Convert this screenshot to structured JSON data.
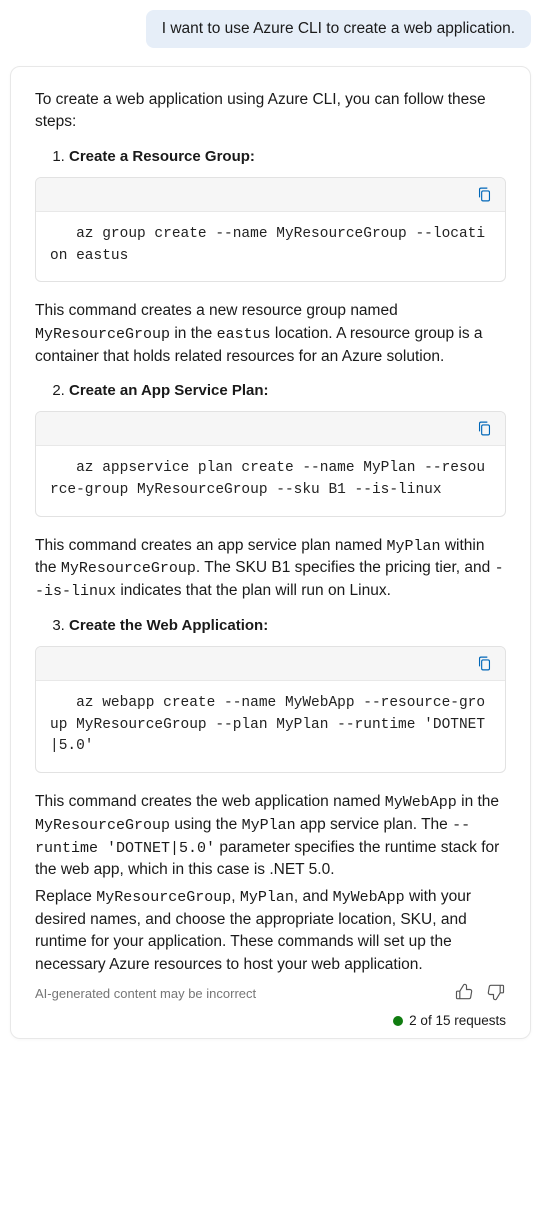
{
  "user_message": "I want to use Azure CLI to create a web application.",
  "response": {
    "intro": "To create a web application using Azure CLI, you can follow these steps:",
    "steps": [
      {
        "num": "1.",
        "title": "Create a Resource Group:"
      },
      {
        "num": "2.",
        "title": "Create an App Service Plan:"
      },
      {
        "num": "3.",
        "title": "Create the Web Application:"
      }
    ],
    "code": {
      "block1": "   az group create --name MyResourceGroup --location eastus",
      "block2": "   az appservice plan create --name MyPlan --resource-group MyResourceGroup --sku B1 --is-linux",
      "block3": "   az webapp create --name MyWebApp --resource-group MyResourceGroup --plan MyPlan --runtime 'DOTNET|5.0'"
    },
    "explain1_a": "This command creates a new resource group named ",
    "explain1_code1": "MyResourceGroup",
    "explain1_b": " in the ",
    "explain1_code2": "eastus",
    "explain1_c": " location. A resource group is a container that holds related resources for an Azure solution.",
    "explain2_a": "This command creates an app service plan named ",
    "explain2_code1": "MyPlan",
    "explain2_b": " within the ",
    "explain2_code2": "MyResourceGroup",
    "explain2_c": ". The SKU B1 specifies the pricing tier, and ",
    "explain2_code3": "--is-linux",
    "explain2_d": " indicates that the plan will run on Linux.",
    "explain3_a": "This command creates the web application named ",
    "explain3_code1": "MyWebApp",
    "explain3_b": " in the ",
    "explain3_code2": "MyResourceGroup",
    "explain3_c": " using the ",
    "explain3_code3": "MyPlan",
    "explain3_d": " app service plan. The ",
    "explain3_code4": "--runtime 'DOTNET|5.0'",
    "explain3_e": " parameter specifies the runtime stack for the web app, which in this case is .NET 5.0.",
    "closing_a": "Replace ",
    "closing_code1": "MyResourceGroup",
    "closing_b": ", ",
    "closing_code2": "MyPlan",
    "closing_c": ", and ",
    "closing_code3": "MyWebApp",
    "closing_d": " with your desired names, and choose the appropriate location, SKU, and runtime for your application. These commands will set up the necessary Azure resources to host your web application."
  },
  "footer": {
    "disclaimer": "AI-generated content may be incorrect",
    "status": "2 of 15 requests"
  }
}
